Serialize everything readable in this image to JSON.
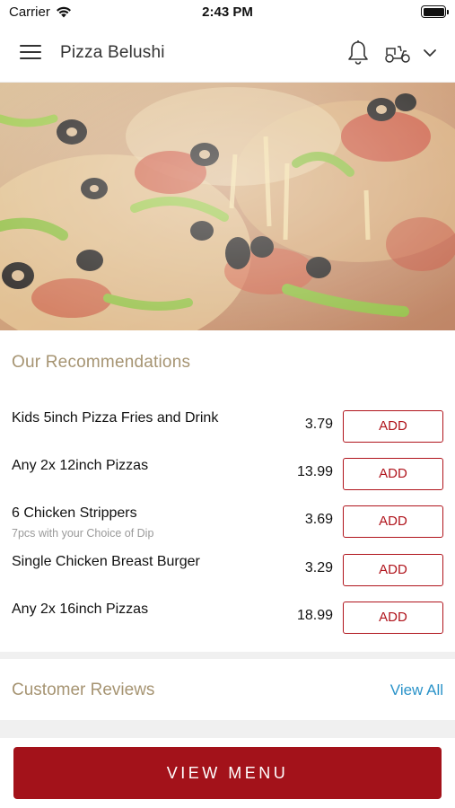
{
  "status_bar": {
    "carrier": "Carrier",
    "time": "2:43 PM"
  },
  "header": {
    "title": "Pizza Belushi",
    "icons": [
      "menu-icon",
      "bell-icon",
      "scooter-icon",
      "chevron-down-icon"
    ]
  },
  "hero": {
    "image": "pizza-photo"
  },
  "recommendations": {
    "title": "Our Recommendations",
    "add_label": "ADD",
    "items": [
      {
        "name": "Kids 5inch Pizza Fries and Drink",
        "subtitle": "",
        "price": "3.79"
      },
      {
        "name": "Any 2x 12inch Pizzas",
        "subtitle": "",
        "price": "13.99"
      },
      {
        "name": "6 Chicken Strippers",
        "subtitle": "7pcs with your Choice of Dip",
        "price": "3.69"
      },
      {
        "name": "Single Chicken Breast Burger",
        "subtitle": "",
        "price": "3.29"
      },
      {
        "name": "Any 2x 16inch Pizzas",
        "subtitle": "",
        "price": "18.99"
      }
    ]
  },
  "reviews": {
    "title": "Customer Reviews",
    "view_all": "View All"
  },
  "footer": {
    "view_menu": "VIEW MENU"
  },
  "colors": {
    "accent_red": "#a3121a",
    "section_title": "#a69472",
    "link_blue": "#2a93c9"
  }
}
